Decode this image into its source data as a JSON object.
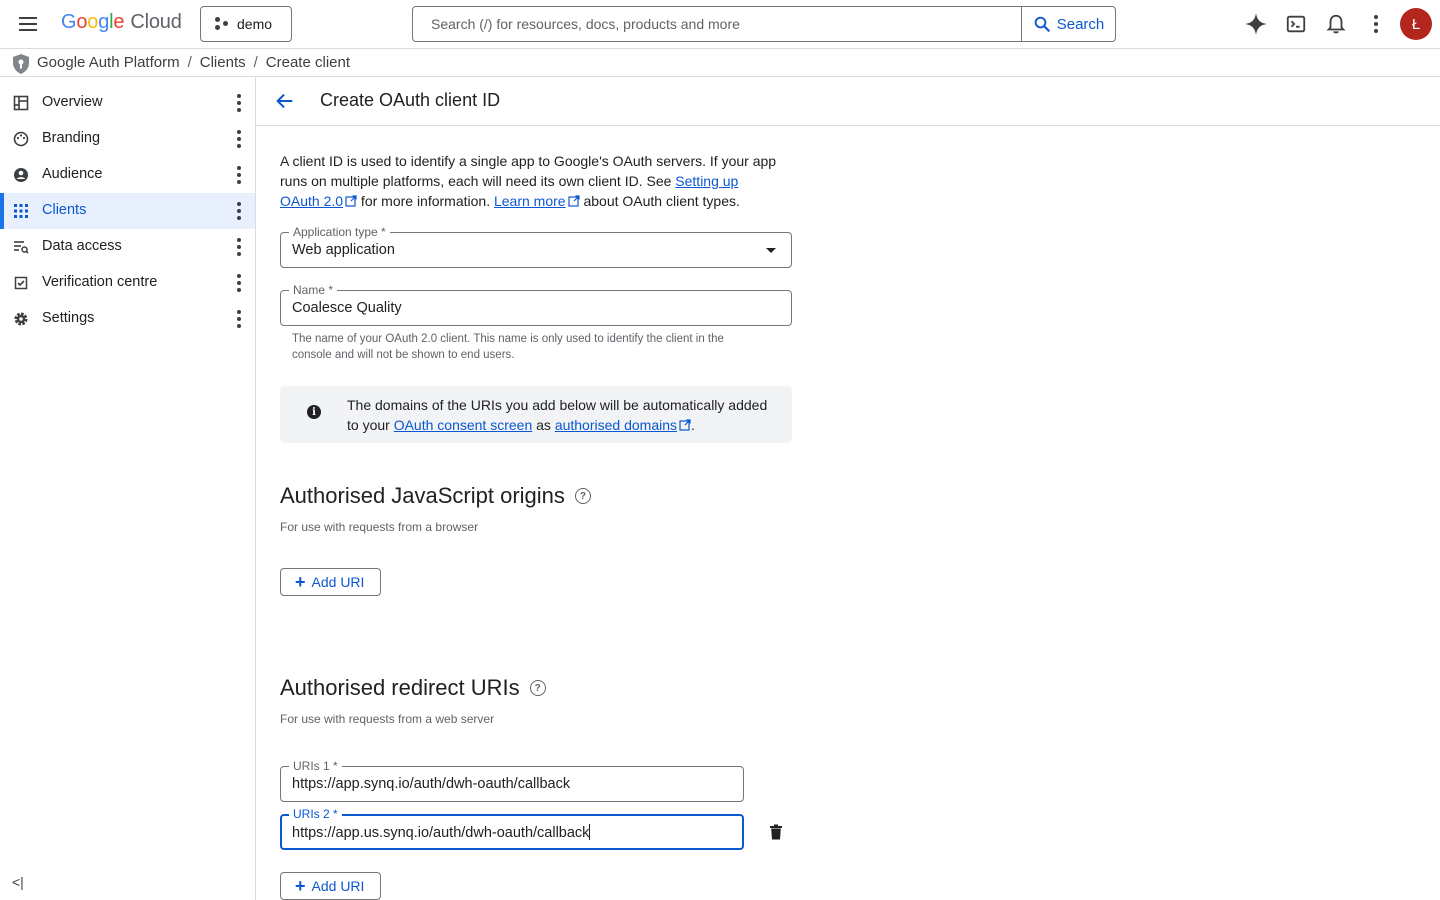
{
  "topbar": {
    "logo_google": [
      "G",
      "o",
      "o",
      "g",
      "l",
      "e"
    ],
    "logo_cloud": "Cloud",
    "project": "demo",
    "search_placeholder": "Search (/) for resources, docs, products and more",
    "search_button": "Search",
    "avatar_initial": "Ł"
  },
  "breadcrumb": {
    "items": [
      "Google Auth Platform",
      "Clients",
      "Create client"
    ],
    "separator": "/"
  },
  "sidebar": {
    "items": [
      {
        "label": "Overview",
        "icon": "dashboard-icon"
      },
      {
        "label": "Branding",
        "icon": "palette-icon"
      },
      {
        "label": "Audience",
        "icon": "account-circle-icon"
      },
      {
        "label": "Clients",
        "icon": "apps-grid-icon",
        "active": true
      },
      {
        "label": "Data access",
        "icon": "data-access-icon"
      },
      {
        "label": "Verification centre",
        "icon": "verified-icon"
      },
      {
        "label": "Settings",
        "icon": "gear-icon"
      }
    ],
    "collapse_label": "<|"
  },
  "main": {
    "title": "Create OAuth client ID",
    "intro_1": "A client ID is used to identify a single app to Google's OAuth servers. If your app runs on multiple platforms, each will need its own client ID. See ",
    "intro_link_1": "Setting up OAuth 2.0",
    "intro_2": " for more information. ",
    "intro_link_2": "Learn more",
    "intro_3": " about OAuth client types.",
    "app_type_label": "Application type *",
    "app_type_value": "Web application",
    "name_label": "Name *",
    "name_value": "Coalesce Quality",
    "name_helper": "The name of your OAuth 2.0 client. This name is only used to identify the client in the console and will not be shown to end users.",
    "info_1": "The domains of the URIs you add below will be automatically added to your ",
    "info_link_1": "OAuth consent screen",
    "info_2": " as ",
    "info_link_2": "authorised domains",
    "info_3": ".",
    "js_origins": {
      "title": "Authorised JavaScript origins",
      "subtitle": "For use with requests from a browser",
      "add_button": "Add URI"
    },
    "redirect_uris": {
      "title": "Authorised redirect URIs",
      "subtitle": "For use with requests from a web server",
      "uri1_label": "URIs 1 *",
      "uri1_value": "https://app.synq.io/auth/dwh-oauth/callback",
      "uri2_label": "URIs 2 *",
      "uri2_value": "https://app.us.synq.io/auth/dwh-oauth/callback",
      "add_button": "Add URI"
    }
  },
  "colors": {
    "accent": "#0b57d0",
    "active_nav_bg": "#e8f0fe",
    "avatar_bg": "#b3261e"
  }
}
